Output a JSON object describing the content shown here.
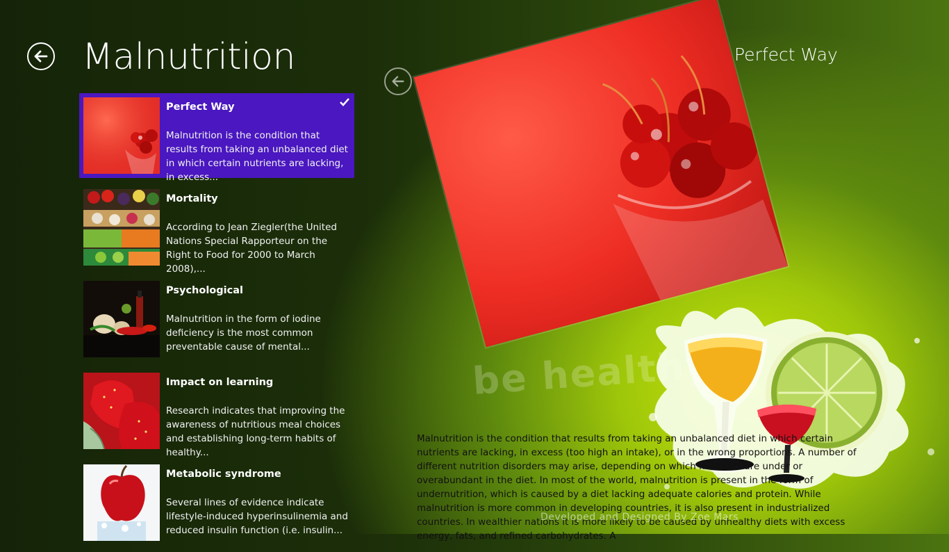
{
  "page": {
    "title": "Malnutrition"
  },
  "list": {
    "items": [
      {
        "title": "Perfect Way",
        "description": "Malnutrition is the condition that results from taking an unbalanced diet in which certain nutrients are lacking, in excess...",
        "selected": true
      },
      {
        "title": "Mortality",
        "description": "According to Jean Ziegler(the United Nations Special Rapporteur on the Right to Food for 2000 to March 2008),..."
      },
      {
        "title": "Psychological",
        "description": "Malnutrition in the form of iodine deficiency is the most common preventable cause of mental..."
      },
      {
        "title": "Impact on learning",
        "description": "Research indicates that improving the awareness of nutritious meal choices and establishing long-term habits of healthy..."
      },
      {
        "title": "Metabolic syndrome",
        "description": "Several lines of evidence indicate lifestyle-induced hyperinsulinemia and reduced insulin function (i.e. insulin..."
      }
    ]
  },
  "detail": {
    "title": "Perfect Way",
    "body": "Malnutrition is the condition that results from taking an unbalanced diet in which certain nutrients are lacking, in excess (too high an intake), or in the wrong proportions. A number of different nutrition disorders may arise, depending on which nutrients are under or overabundant in the diet. In most of the world, malnutrition is present in the form of undernutrition, which is caused by a diet lacking adequate calories and protein. While malnutrition is more common in developing countries, it is also present in industrialized countries. In wealthier nations it is more likely to be caused by unhealthy diets with excess energy, fats, and refined carbohydrates. A",
    "watermark": "be healthy",
    "credit": "Developed and Designed By Zoe Mars"
  },
  "colors": {
    "accent_selected": "#4a17c0"
  }
}
